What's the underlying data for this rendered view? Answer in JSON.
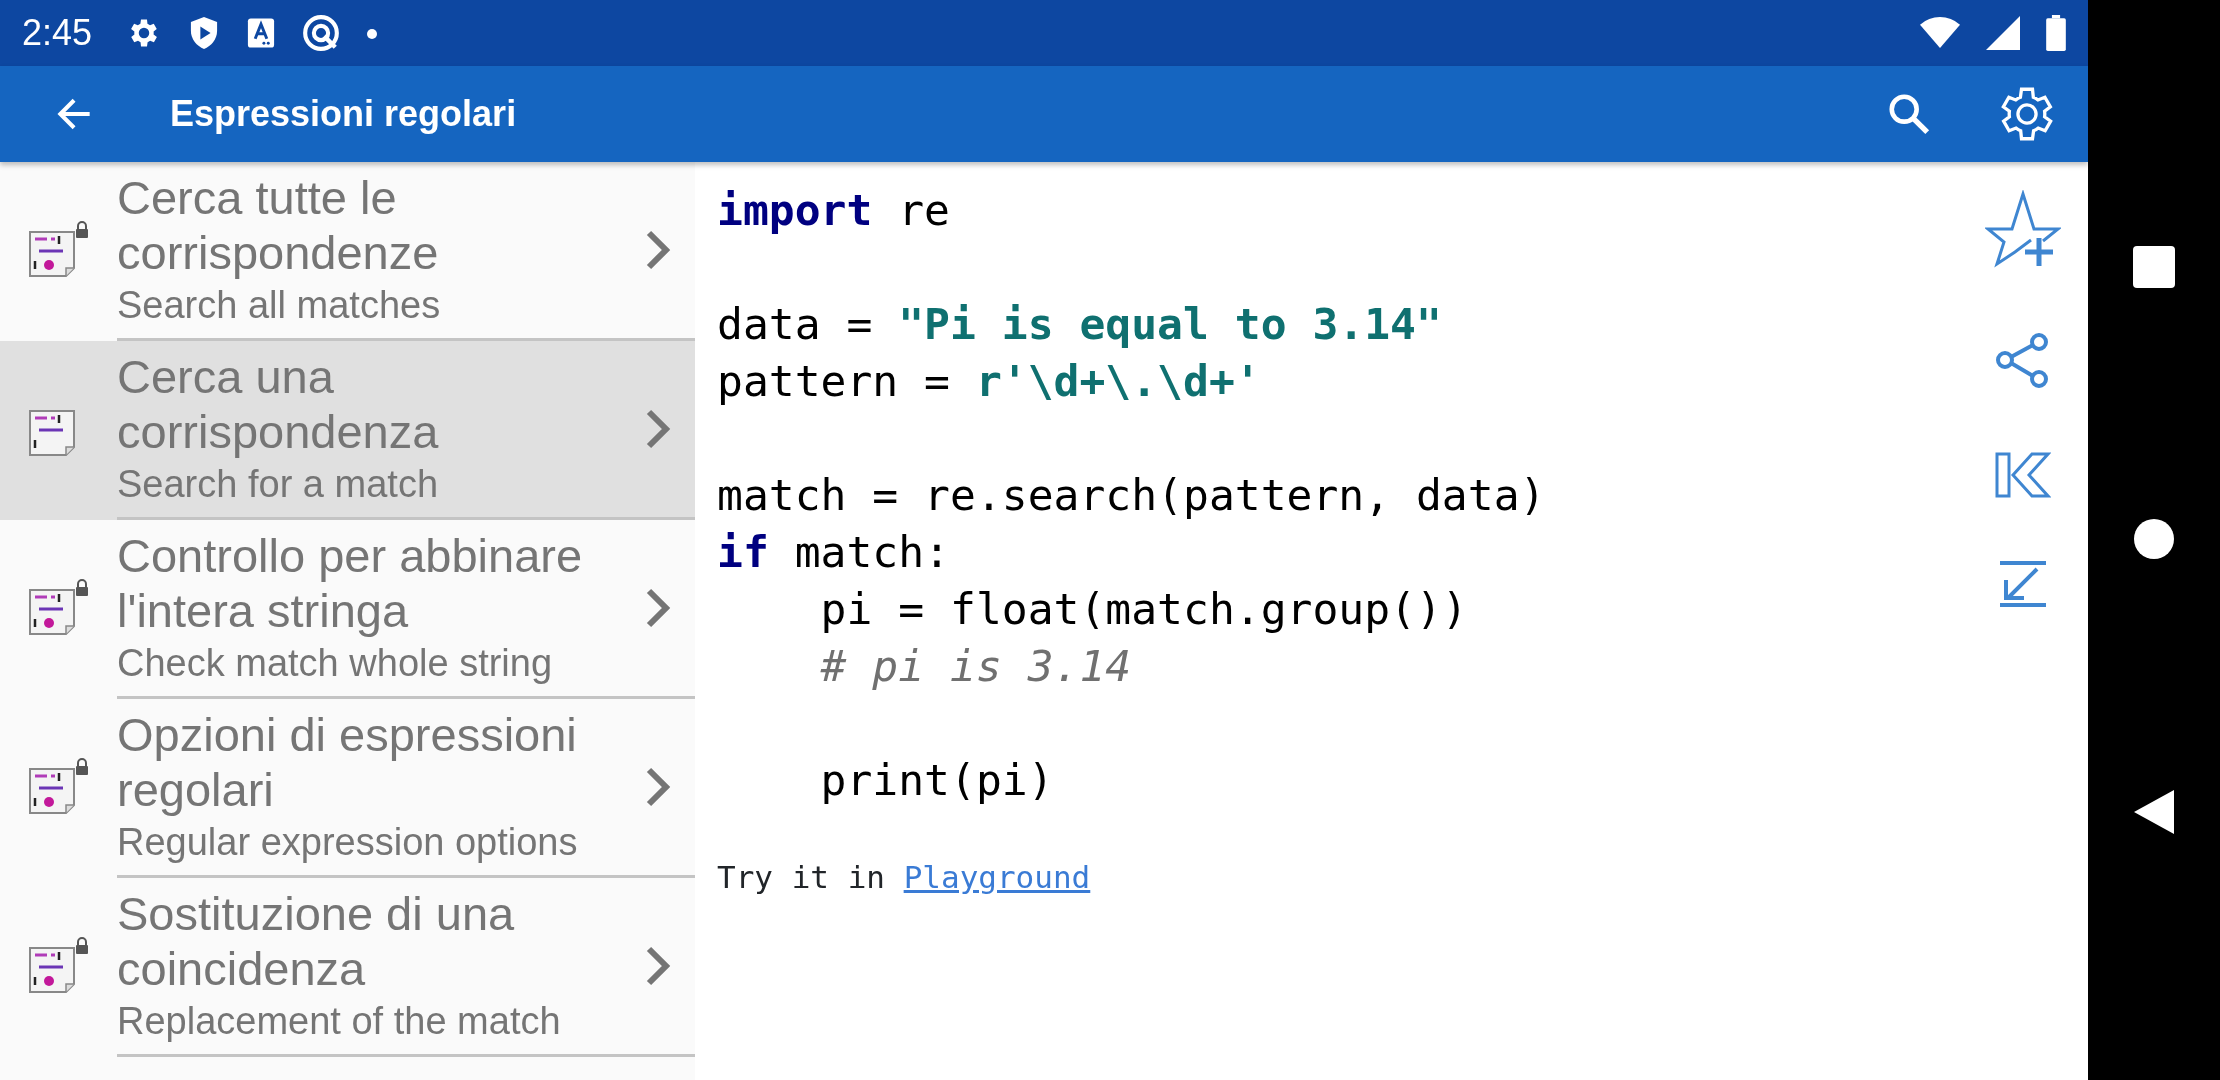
{
  "status_bar": {
    "time": "2:45"
  },
  "app_bar": {
    "title": "Espressioni regolari"
  },
  "items": [
    {
      "title": "Cerca tutte le corrispondenze",
      "subtitle": "Search all matches",
      "locked": true,
      "selected": false
    },
    {
      "title": "Cerca una corrispondenza",
      "subtitle": "Search for a match",
      "locked": false,
      "selected": true
    },
    {
      "title": "Controllo per abbinare l'intera stringa",
      "subtitle": "Check match whole string",
      "locked": true,
      "selected": false
    },
    {
      "title": "Opzioni di espressioni regolari",
      "subtitle": "Regular expression options",
      "locked": true,
      "selected": false
    },
    {
      "title": "Sostituzione di una coincidenza",
      "subtitle": "Replacement of the match",
      "locked": true,
      "selected": false
    }
  ],
  "code_blocks": [
    [
      [
        {
          "text": "import",
          "kind": "keyword"
        },
        {
          "text": " re",
          "kind": "plain"
        }
      ]
    ],
    [
      [
        {
          "text": "data = ",
          "kind": "plain"
        },
        {
          "text": "\"Pi is equal to 3.14\"",
          "kind": "string"
        }
      ],
      [
        {
          "text": "pattern = ",
          "kind": "plain"
        },
        {
          "text": "r'\\d+\\.\\d+'",
          "kind": "string"
        }
      ]
    ],
    [
      [
        {
          "text": "match = re.search(pattern, data)",
          "kind": "plain"
        }
      ],
      [
        {
          "text": "if",
          "kind": "keyword"
        },
        {
          "text": " match:",
          "kind": "plain"
        }
      ],
      [
        {
          "text": "    pi = float(match.group())",
          "kind": "plain"
        }
      ],
      [
        {
          "text": "    # pi is 3.14",
          "kind": "comment"
        }
      ]
    ],
    [
      [
        {
          "text": "    print(pi)",
          "kind": "plain"
        }
      ]
    ]
  ],
  "try_it": {
    "text": "Try it in",
    "link": "Playground"
  }
}
